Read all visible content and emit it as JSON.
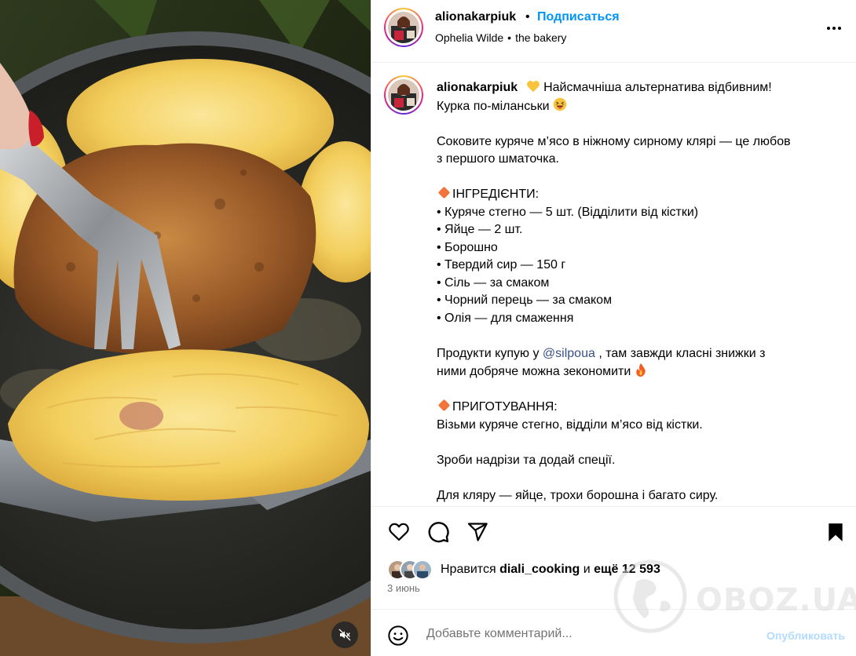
{
  "header": {
    "username": "alionakarpiuk",
    "separator": "•",
    "follow_label": "Подписаться",
    "audio_artist": "Ophelia Wilde",
    "audio_dot": "•",
    "audio_track": "the bakery",
    "more_icon": "more-horizontal-icon"
  },
  "caption": {
    "username": "alionakarpiuk",
    "line1": "Найсмачніша альтернатива відбивним!",
    "line2": "Курка по-міланськи",
    "para1_line1": "Соковите куряче м’ясо в ніжному сирному клярі — це любов",
    "para1_line2": "з першого шматочка.",
    "ingredients_title": "ІНГРЕДІЄНТИ:",
    "ingredients": [
      "• Куряче стегно — 5 шт. (Відділити від кістки)",
      "• Яйце — 2 шт.",
      "• Борошно",
      "• Твердий сир — 150 г",
      "• Сіль — за смаком",
      "• Чорний перець — за смаком",
      "• Олія — для смаження"
    ],
    "products_before": "Продукти купую у",
    "products_mention": "@silpoua",
    "products_after": ", там завжди класні знижки з",
    "products_line2": "ними добряче можна зекономити",
    "method_title": "ПРИГОТУВАННЯ:",
    "step1": "Візьми куряче стегно, відділи м’ясо від кістки.",
    "step2": "Зроби надрізи та додай спеції.",
    "step3": "Для кляру — яйце, трохи борошна і багато сиру."
  },
  "actions": {
    "like_icon": "heart-icon",
    "comment_icon": "comment-icon",
    "share_icon": "share-icon",
    "save_icon": "bookmark-icon"
  },
  "likes": {
    "prefix": "Нравится",
    "user": "diali_cooking",
    "middle": "и",
    "count": "ещё 12 593"
  },
  "date": "3 июнь",
  "comment": {
    "placeholder": "Добавьте комментарий...",
    "post_label": "Опубликовать",
    "emoji_icon": "emoji-smile-icon"
  },
  "watermark": "OBOZ.UA",
  "media": {
    "mute_icon": "speaker-muted-icon"
  },
  "colors": {
    "accent": "#0095f6",
    "mention": "#385185",
    "muted": "#737373",
    "post_disabled": "#b3dbff",
    "diamond": "#f2733b"
  }
}
